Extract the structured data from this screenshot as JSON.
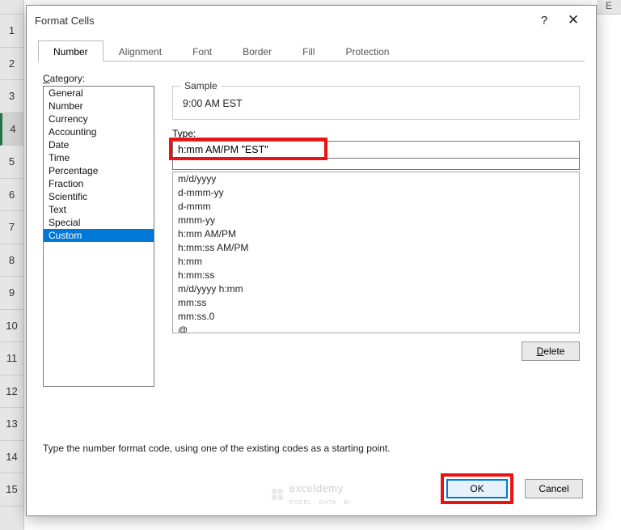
{
  "spreadsheet": {
    "column_letter": "E",
    "rows": [
      "1",
      "2",
      "3",
      "4",
      "5",
      "6",
      "7",
      "8",
      "9",
      "10",
      "11",
      "12",
      "13",
      "14",
      "15"
    ],
    "selected_row_index": 3
  },
  "dialog": {
    "title": "Format Cells",
    "help_label": "?",
    "close_label": "✕",
    "tabs": [
      {
        "label": "Number",
        "active": true
      },
      {
        "label": "Alignment",
        "active": false
      },
      {
        "label": "Font",
        "active": false
      },
      {
        "label": "Border",
        "active": false
      },
      {
        "label": "Fill",
        "active": false
      },
      {
        "label": "Protection",
        "active": false
      }
    ],
    "category_label_pre": "C",
    "category_label_rest": "ategory:",
    "categories": [
      "General",
      "Number",
      "Currency",
      "Accounting",
      "Date",
      "Time",
      "Percentage",
      "Fraction",
      "Scientific",
      "Text",
      "Special",
      "Custom"
    ],
    "category_selected": "Custom",
    "sample_label": "Sample",
    "sample_value": "9:00 AM EST",
    "type_label_pre": "T",
    "type_label_rest": "ype:",
    "type_value": "h:mm AM/PM \"EST\"",
    "format_list": [
      "m/d/yyyy",
      "d-mmm-yy",
      "d-mmm",
      "mmm-yy",
      "h:mm AM/PM",
      "h:mm:ss AM/PM",
      "h:mm",
      "h:mm:ss",
      "m/d/yyyy h:mm",
      "mm:ss",
      "mm:ss.0",
      "@"
    ],
    "delete_label": "Delete",
    "instruction": "Type the number format code, using one of the existing codes as a starting point.",
    "ok_label": "OK",
    "cancel_label": "Cancel"
  },
  "watermark_text": "exceldemy",
  "watermark_sub": "EXCEL · DATA · BI"
}
